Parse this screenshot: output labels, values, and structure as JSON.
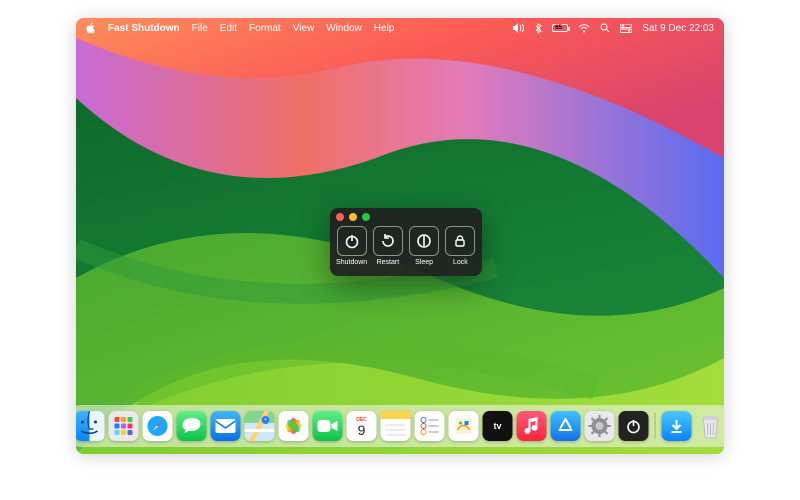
{
  "menubar": {
    "app_name": "Fast Shutdown",
    "items": [
      "File",
      "Edit",
      "Format",
      "View",
      "Window",
      "Help"
    ],
    "status": {
      "battery_label": "65",
      "datetime": "Sat 9 Dec  22:03"
    }
  },
  "window": {
    "actions": {
      "shutdown": "Shutdown",
      "restart": "Restart",
      "sleep": "Sleep",
      "lock": "Lock"
    }
  },
  "dock": {
    "items": [
      {
        "name": "finder"
      },
      {
        "name": "launchpad"
      },
      {
        "name": "safari"
      },
      {
        "name": "messages"
      },
      {
        "name": "mail"
      },
      {
        "name": "maps"
      },
      {
        "name": "photos"
      },
      {
        "name": "facetime"
      },
      {
        "name": "calendar",
        "badge": "9",
        "badge_top": "DEC"
      },
      {
        "name": "notes"
      },
      {
        "name": "reminders"
      },
      {
        "name": "freeform"
      },
      {
        "name": "tv"
      },
      {
        "name": "music"
      },
      {
        "name": "appstore"
      },
      {
        "name": "settings"
      },
      {
        "name": "fastshutdown"
      }
    ],
    "recent": [
      {
        "name": "downloads"
      },
      {
        "name": "trash"
      }
    ]
  }
}
